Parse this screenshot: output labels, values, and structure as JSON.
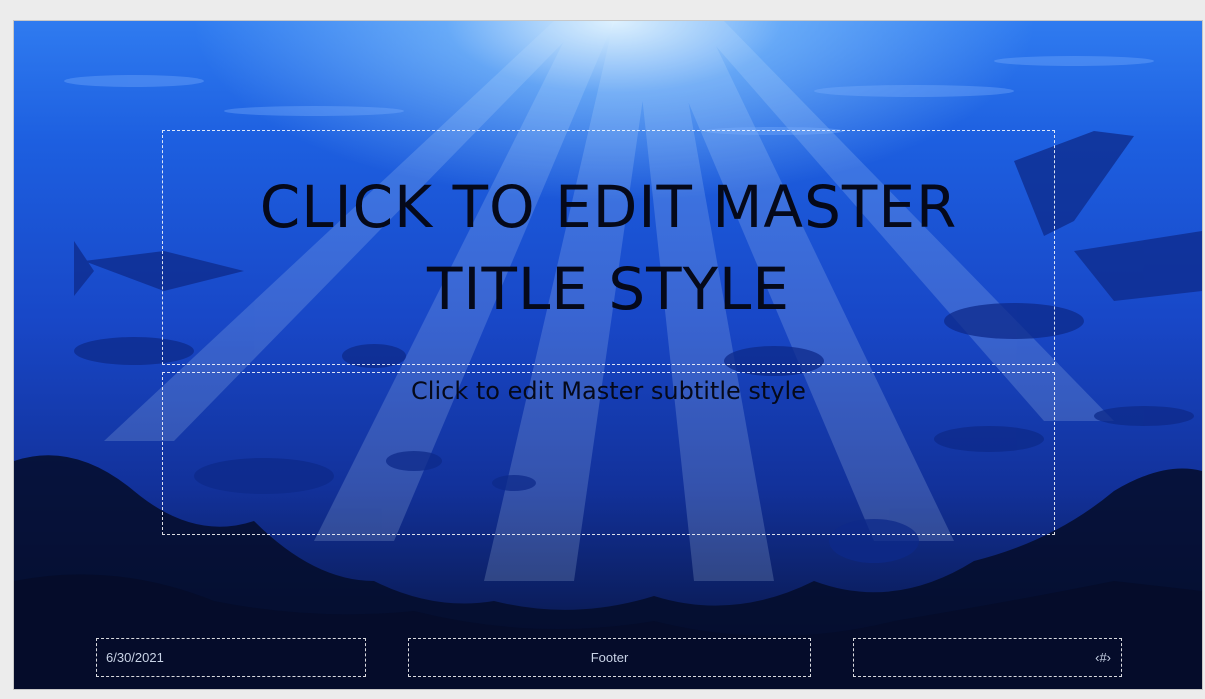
{
  "slide": {
    "title": "CLICK TO EDIT MASTER TITLE STYLE",
    "subtitle": "Click to edit Master subtitle style",
    "date": "6/30/2021",
    "footer": "Footer",
    "slide_number": "‹#›"
  },
  "colors": {
    "water_top": "#2f7bf0",
    "water_bottom": "#07112f",
    "text": "#05091a",
    "placeholder_border": "#ffffff"
  }
}
